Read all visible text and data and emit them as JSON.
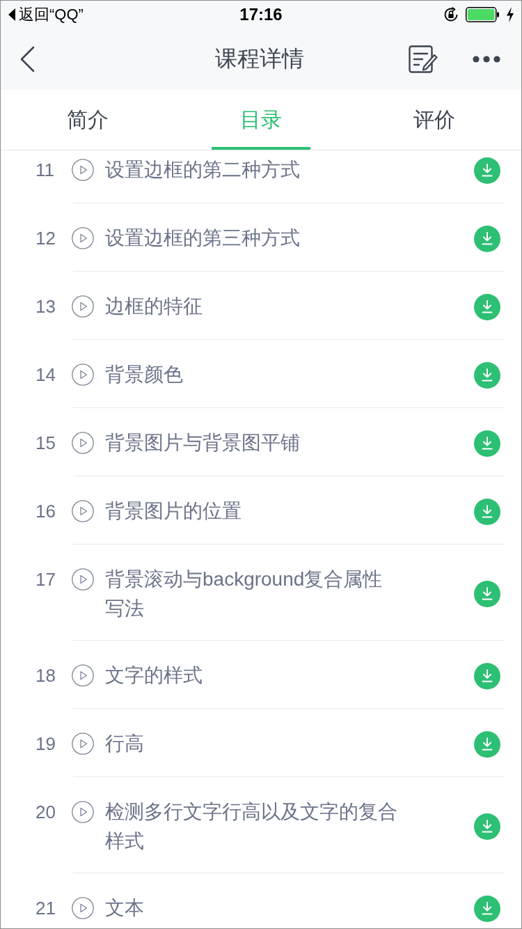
{
  "status_bar": {
    "back_label": "返回“QQ”",
    "time": "17:16"
  },
  "nav_bar": {
    "title": "课程详情"
  },
  "tabs": [
    {
      "label": "简介",
      "selected": false
    },
    {
      "label": "目录",
      "selected": true
    },
    {
      "label": "评价",
      "selected": false
    }
  ],
  "lessons": [
    {
      "number": "11",
      "title": "设置边框的第二种方式"
    },
    {
      "number": "12",
      "title": "设置边框的第三种方式"
    },
    {
      "number": "13",
      "title": "边框的特征"
    },
    {
      "number": "14",
      "title": "背景颜色"
    },
    {
      "number": "15",
      "title": "背景图片与背景图平铺"
    },
    {
      "number": "16",
      "title": "背景图片的位置"
    },
    {
      "number": "17",
      "title": "背景滚动与background复合属性写法"
    },
    {
      "number": "18",
      "title": "文字的样式"
    },
    {
      "number": "19",
      "title": "行高"
    },
    {
      "number": "20",
      "title": "检测多行文字行高以及文字的复合样式"
    },
    {
      "number": "21",
      "title": "文本"
    }
  ]
}
